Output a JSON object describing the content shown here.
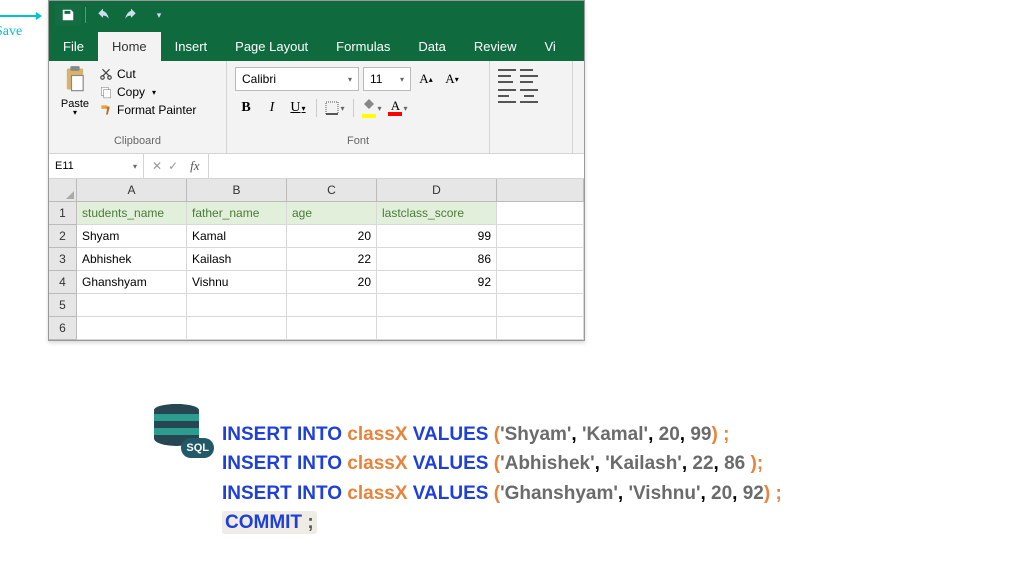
{
  "annotation": {
    "label": "Save"
  },
  "qat": {
    "save": "save",
    "undo": "undo",
    "redo": "redo"
  },
  "tabs": [
    "File",
    "Home",
    "Insert",
    "Page Layout",
    "Formulas",
    "Data",
    "Review",
    "Vi"
  ],
  "active_tab": "Home",
  "ribbon": {
    "clipboard": {
      "title": "Clipboard",
      "paste": "Paste",
      "cut": "Cut",
      "copy": "Copy",
      "format_painter": "Format Painter"
    },
    "font": {
      "title": "Font",
      "name": "Calibri",
      "size": "11"
    },
    "align": {
      "title": ""
    }
  },
  "namebox": {
    "ref": "E11",
    "fx": "fx"
  },
  "columns": [
    "A",
    "B",
    "C",
    "D",
    ""
  ],
  "rows": [
    "1",
    "2",
    "3",
    "4",
    "5",
    "6"
  ],
  "headers": [
    "students_name",
    "father_name",
    "age",
    "lastclass_score"
  ],
  "data": [
    [
      "Shyam",
      "Kamal",
      "20",
      "99"
    ],
    [
      "Abhishek",
      "Kailash",
      "22",
      "86"
    ],
    [
      "Ghanshyam",
      "Vishnu",
      "20",
      "92"
    ]
  ],
  "chart_data": {
    "type": "table",
    "columns": [
      "students_name",
      "father_name",
      "age",
      "lastclass_score"
    ],
    "rows": [
      {
        "students_name": "Shyam",
        "father_name": "Kamal",
        "age": 20,
        "lastclass_score": 99
      },
      {
        "students_name": "Abhishek",
        "father_name": "Kailash",
        "age": 22,
        "lastclass_score": 86
      },
      {
        "students_name": "Ghanshyam",
        "father_name": "Vishnu",
        "age": 20,
        "lastclass_score": 92
      }
    ]
  },
  "sql": {
    "badge": "SQL",
    "insert": "INSERT INTO",
    "values": "VALUES",
    "table": "classX",
    "commit": "COMMIT",
    "rows": [
      {
        "s1": "'Shyam'",
        "s2": "'Kamal'",
        "n1": "20",
        "n2": "99",
        "tail": ") ;"
      },
      {
        "s1": "'Abhishek'",
        "s2": "'Kailash'",
        "n1": "22",
        "n2": "86",
        "tail": " );"
      },
      {
        "s1": "'Ghanshyam'",
        "s2": "'Vishnu'",
        "n1": "20",
        "n2": "92",
        "tail": ") ;"
      }
    ],
    "semi": ";"
  }
}
